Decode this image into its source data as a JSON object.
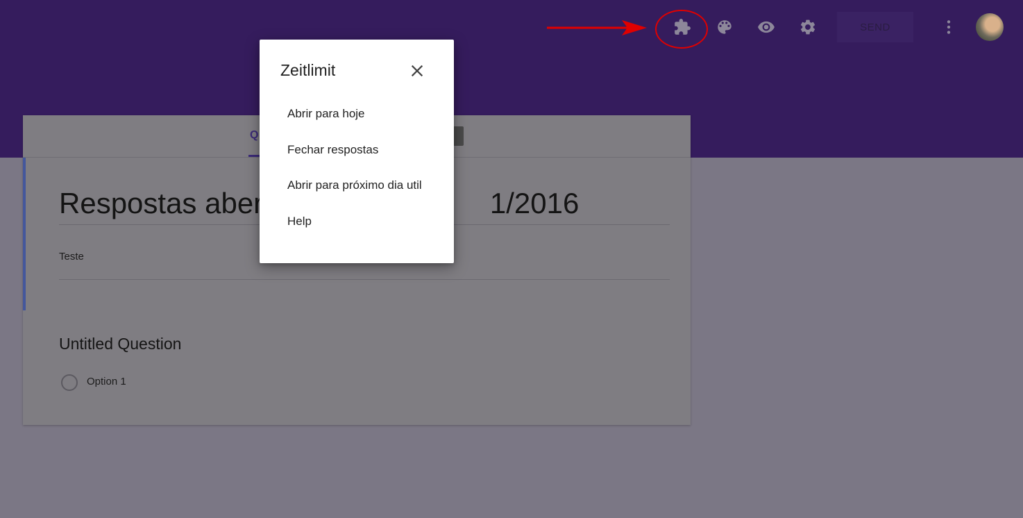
{
  "header": {
    "send_label": "SEND",
    "icons": [
      "add-ons-puzzle-icon",
      "palette-icon",
      "preview-eye-icon",
      "settings-gear-icon",
      "more-vert-icon"
    ],
    "annotation_color": "#e00000",
    "background_color": "#351c5d"
  },
  "form": {
    "tab_label_partial": "Q",
    "title": "Respostas aber                            1/2016",
    "description": "Teste",
    "question_title": "Untitled Question",
    "options": [
      "Option 1"
    ]
  },
  "dialog": {
    "title": "Zeitlimit",
    "items": [
      "Abrir para hoje",
      "Fechar respostas",
      "Abrir para próximo dia util",
      "Help"
    ]
  }
}
